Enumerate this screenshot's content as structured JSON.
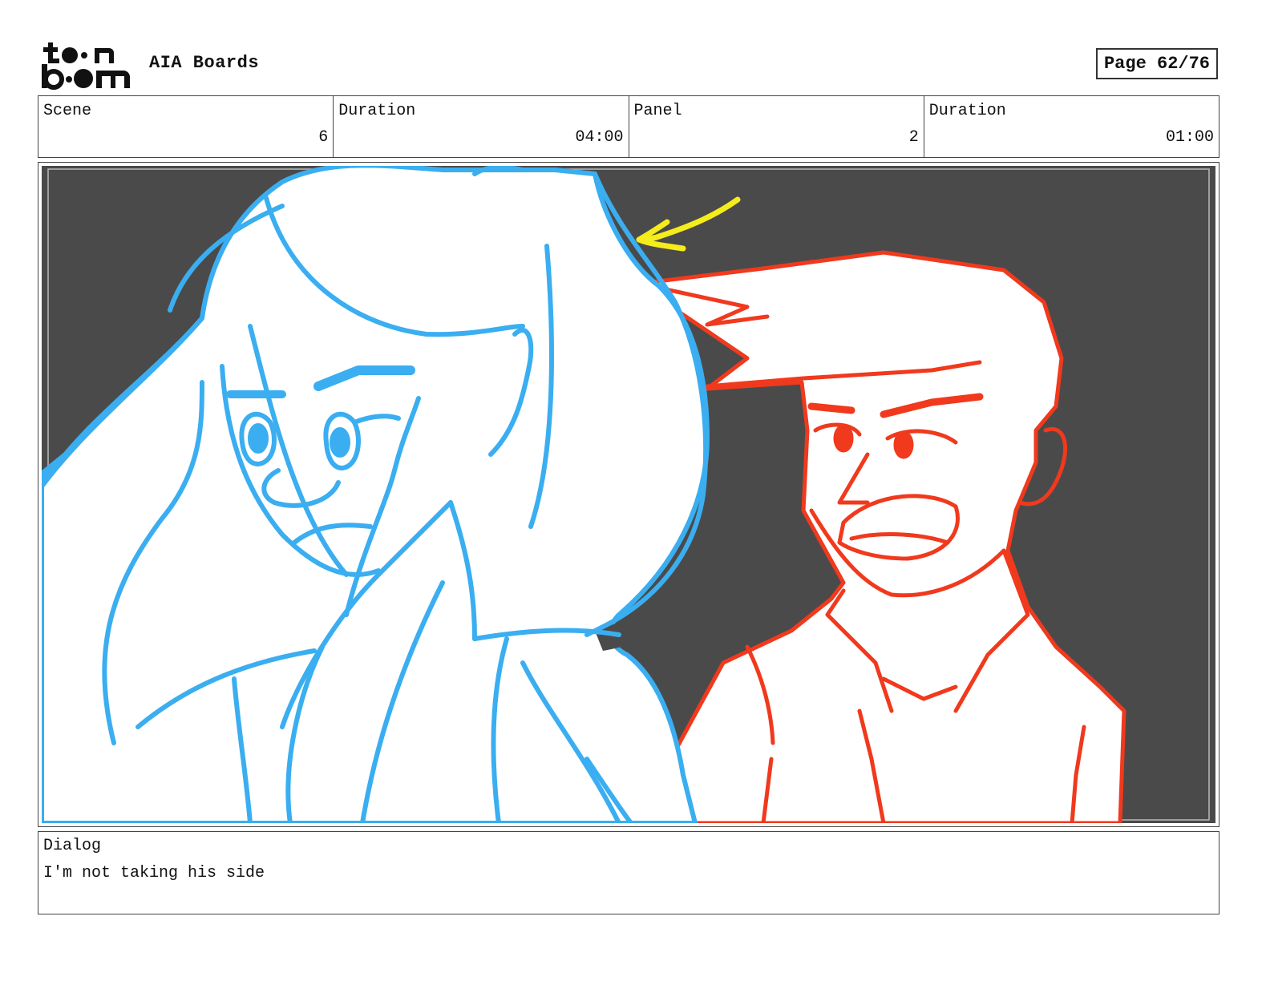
{
  "header": {
    "logo_text": "toon boom",
    "project_title": "AIA Boards",
    "page_label": "Page 62/76"
  },
  "info": {
    "scene_label": "Scene",
    "scene_value": "6",
    "scene_duration_label": "Duration",
    "scene_duration_value": "04:00",
    "panel_label": "Panel",
    "panel_value": "2",
    "panel_duration_label": "Duration",
    "panel_duration_value": "01:00"
  },
  "dialog": {
    "label": "Dialog",
    "text": "I'm not taking his side"
  },
  "colors": {
    "background_fill": "#4a4a4a",
    "girl_line": "#3aaef0",
    "boy_line": "#f0391d",
    "arrow": "#f5ec1c"
  }
}
